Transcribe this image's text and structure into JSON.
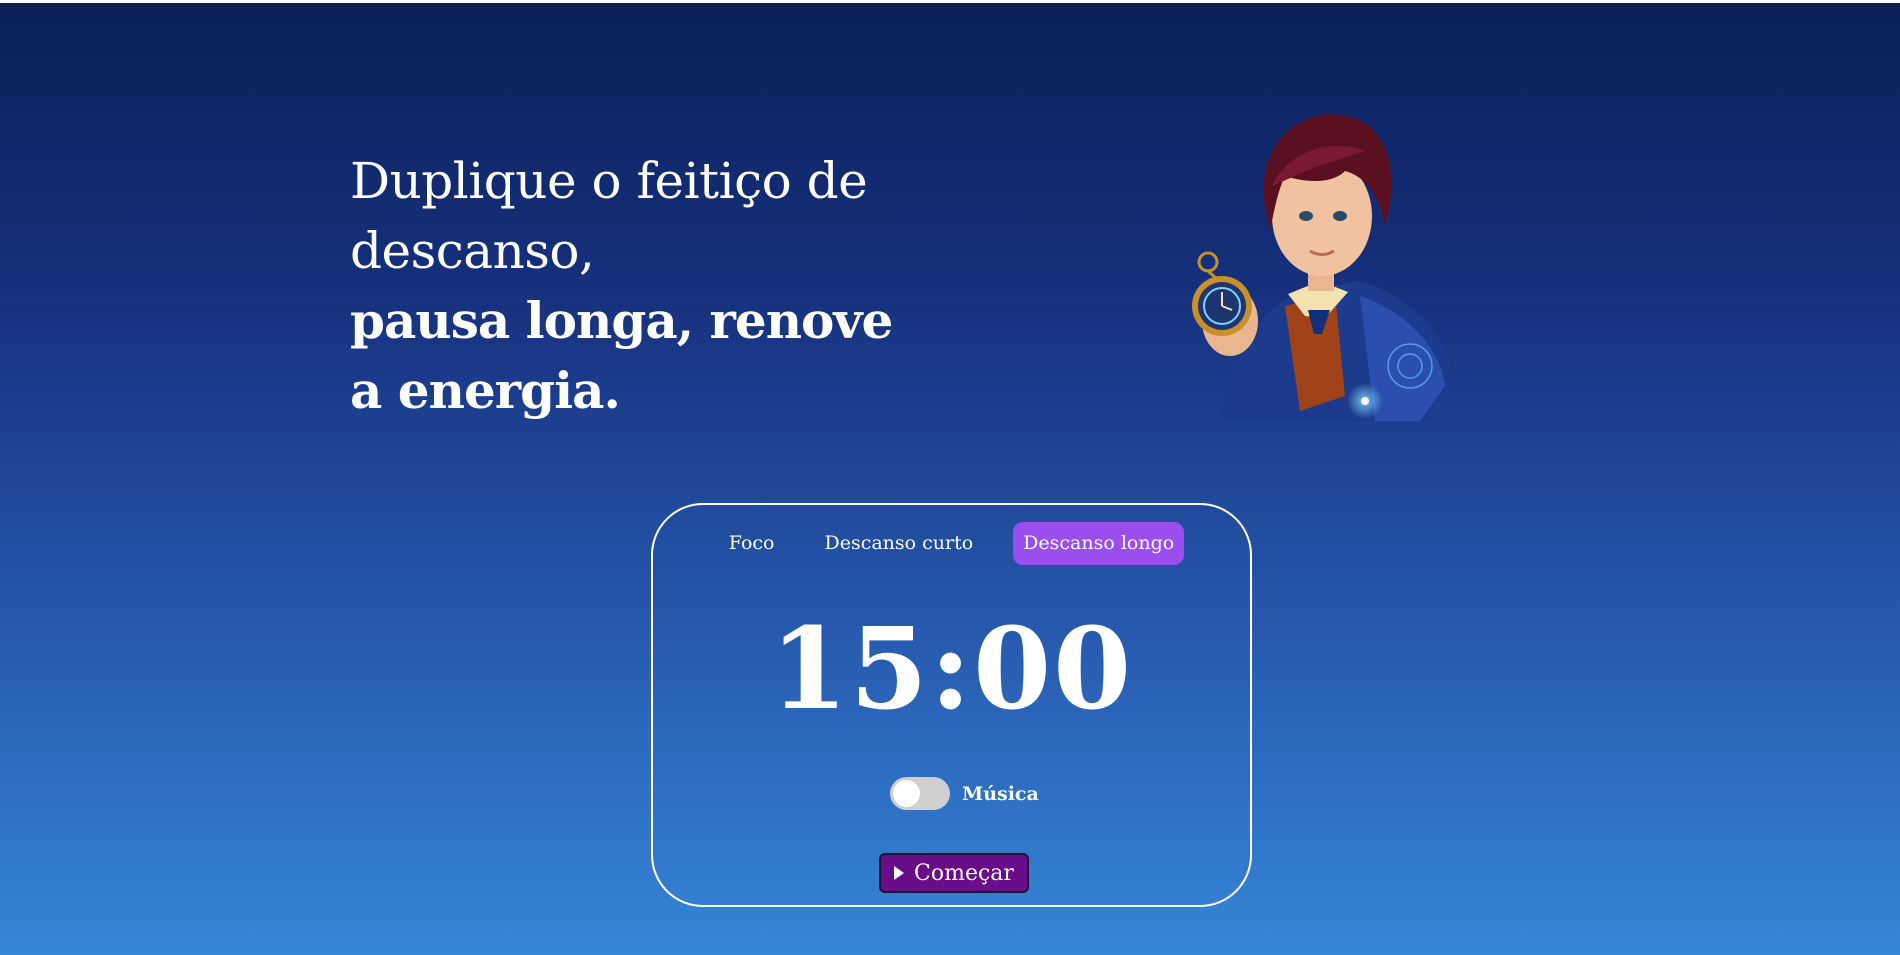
{
  "hero": {
    "line1": "Duplique o feitiço de descanso,",
    "line2": "pausa longa, renove a energia."
  },
  "character_image": {
    "icon": "wizard-with-pocket-watch-illustration",
    "colors": {
      "hair": "#5a1020",
      "skin": "#f0c2a0",
      "coat": "#1d3b8c",
      "vest": "#a0421a",
      "watch": "#c8902a"
    }
  },
  "timer_card": {
    "tabs": [
      {
        "label": "Foco",
        "active": false
      },
      {
        "label": "Descanso curto",
        "active": false
      },
      {
        "label": "Descanso longo",
        "active": true
      }
    ],
    "time": "15:00",
    "music_toggle": {
      "label": "Música",
      "on": false
    },
    "start_button": {
      "label": "Começar",
      "icon": "play-icon"
    }
  },
  "colors": {
    "background_top": "#0b2059",
    "background_bottom": "#3686d9",
    "active_tab": "#9a4ef0",
    "start_button": "#6a0d8a",
    "toggle_off": "#cfcfcf"
  }
}
